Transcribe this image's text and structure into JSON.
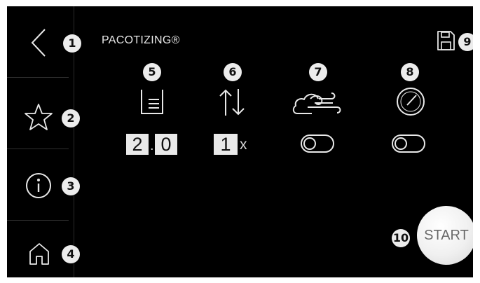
{
  "header": {
    "title": "PACOTIZING®"
  },
  "sidebar": {
    "items": [
      {
        "name": "back",
        "icon": "chevron-left-icon",
        "badge": "1"
      },
      {
        "name": "favorite",
        "icon": "star-icon",
        "badge": "2"
      },
      {
        "name": "info",
        "icon": "info-icon",
        "badge": "3"
      },
      {
        "name": "home",
        "icon": "home-icon",
        "badge": "4"
      }
    ]
  },
  "parameters": {
    "portions": {
      "icon": "beaker-level-icon",
      "badge": "5",
      "digit1": "2",
      "dot": ".",
      "digit2": "0"
    },
    "repeat": {
      "icon": "up-down-arrows-icon",
      "badge": "6",
      "digit": "1",
      "suffix": "x"
    },
    "overrun": {
      "icon": "air-cloud-icon",
      "badge": "7",
      "state": "off"
    },
    "pressure": {
      "icon": "gauge-icon",
      "badge": "8",
      "state": "off"
    }
  },
  "save": {
    "icon": "save-disk-icon",
    "badge": "9"
  },
  "start": {
    "label": "START",
    "badge": "10"
  },
  "colors": {
    "background": "#000000",
    "foreground": "#e8e8e8",
    "badge": "#ececec"
  }
}
